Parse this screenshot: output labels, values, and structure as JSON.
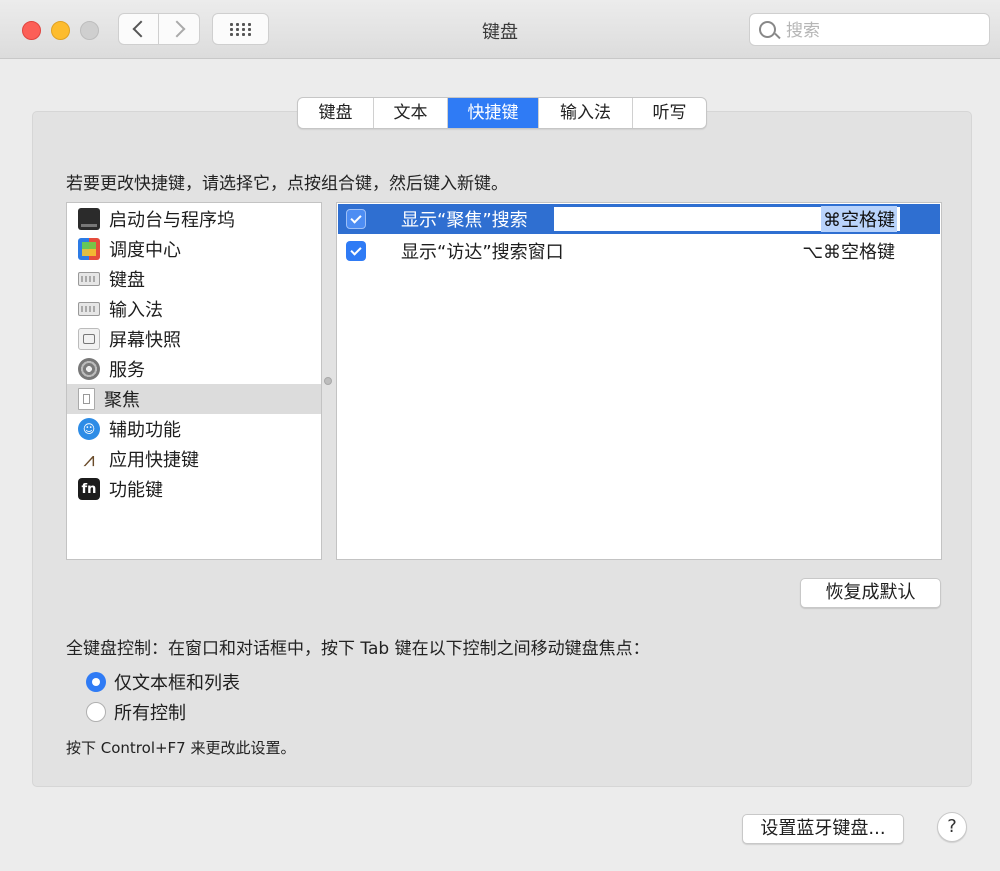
{
  "window": {
    "title": "键盘"
  },
  "toolbar": {
    "search_placeholder": "搜索"
  },
  "tabs": [
    {
      "label": "键盘"
    },
    {
      "label": "文本"
    },
    {
      "label": "快捷键",
      "active": true
    },
    {
      "label": "输入法"
    },
    {
      "label": "听写"
    }
  ],
  "instruction": "若要更改快捷键，请选择它，点按组合键，然后键入新键。",
  "categories": [
    {
      "label": "启动台与程序坞",
      "icon": "launchpad-dock-icon"
    },
    {
      "label": "调度中心",
      "icon": "mission-control-icon"
    },
    {
      "label": "键盘",
      "icon": "keyboard-icon"
    },
    {
      "label": "输入法",
      "icon": "input-method-icon"
    },
    {
      "label": "屏幕快照",
      "icon": "screenshot-icon"
    },
    {
      "label": "服务",
      "icon": "services-gear-icon"
    },
    {
      "label": "聚焦",
      "icon": "spotlight-document-icon",
      "selected": true
    },
    {
      "label": "辅助功能",
      "icon": "accessibility-icon"
    },
    {
      "label": "应用快捷键",
      "icon": "app-shortcuts-icon"
    },
    {
      "label": "功能键",
      "icon": "fn-key-icon"
    }
  ],
  "shortcuts": [
    {
      "name": "显示“聚焦”搜索",
      "key": "⌘空格键",
      "checked": true,
      "selected": true
    },
    {
      "name": "显示“访达”搜索窗口",
      "key": "⌥⌘空格键",
      "checked": true,
      "selected": false
    }
  ],
  "restore_button": "恢复成默认",
  "full_keyboard": {
    "label": "全键盘控制：在窗口和对话框中，按下 Tab 键在以下控制之间移动键盘焦点：",
    "options": [
      {
        "label": "仅文本框和列表",
        "selected": true
      },
      {
        "label": "所有控制",
        "selected": false
      }
    ],
    "note": "按下 Control+F7 来更改此设置。"
  },
  "bluetooth_button": "设置蓝牙键盘...",
  "help_label": "?",
  "colors": {
    "accent": "#2f7bf5",
    "selection": "#2f6fd1"
  }
}
